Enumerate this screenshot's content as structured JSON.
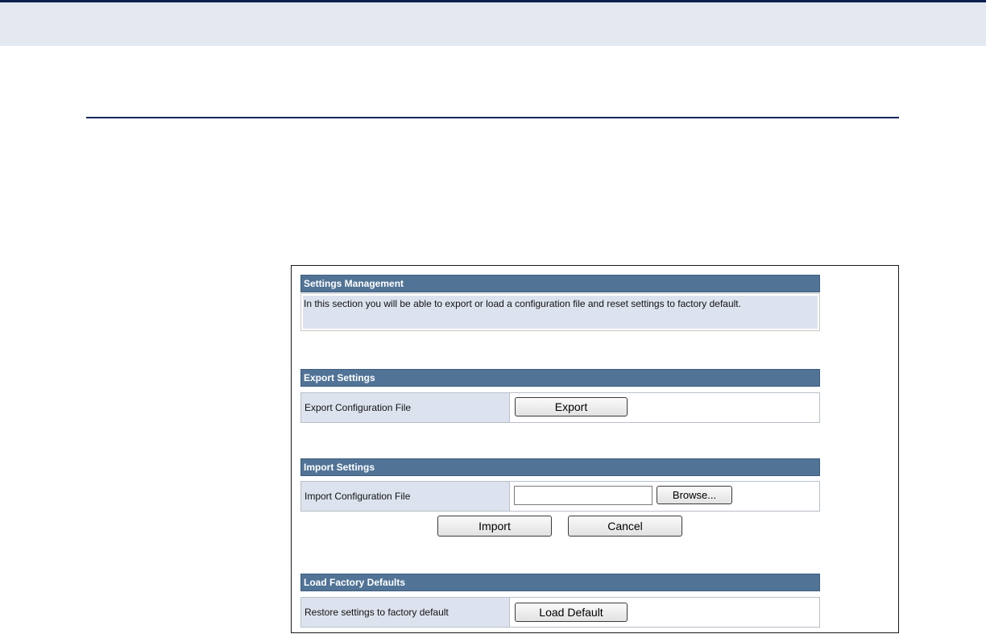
{
  "panel": {
    "settings_management": {
      "title": "Settings Management",
      "description": "In this section you will be able to export or load a configuration file and reset settings to factory default."
    },
    "export": {
      "title": "Export Settings",
      "row_label": "Export Configuration File",
      "button_label": "Export"
    },
    "import": {
      "title": "Import Settings",
      "row_label": "Import Configuration File",
      "file_value": "",
      "browse_label": "Browse...",
      "import_label": "Import",
      "cancel_label": "Cancel"
    },
    "factory": {
      "title": "Load Factory Defaults",
      "row_label": "Restore settings to factory default",
      "button_label": "Load Default"
    }
  },
  "colors": {
    "header_bg": "#507396",
    "label_bg": "#dde3ee",
    "top_band": "#e4e8f1",
    "rule": "#15285a"
  }
}
